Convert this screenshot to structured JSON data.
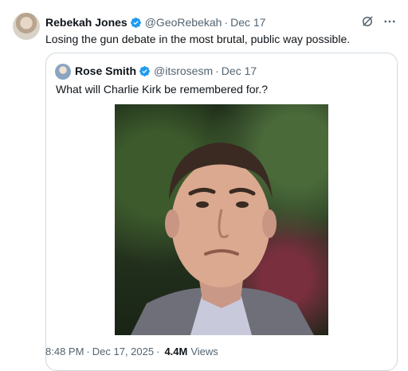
{
  "post": {
    "author_name": "Rebekah Jones",
    "author_handle": "@GeoRebekah",
    "date": "Dec 17",
    "separator": "·",
    "text": "Losing the gun debate in the most brutal, public way possible.",
    "time": "8:48 PM",
    "full_date": "Dec 17, 2025",
    "views_count": "4.4M",
    "views_label": "Views",
    "more_icon": "more-horizontal-icon",
    "grok_icon": "grok-icon"
  },
  "quote": {
    "author_name": "Rose Smith",
    "author_handle": "@itsrosesm",
    "date": "Dec 17",
    "text": "What will Charlie Kirk be remembered for.?"
  },
  "colors": {
    "verified": "#1d9bf0",
    "secondary_text": "#536471",
    "border": "#cfd9de"
  }
}
